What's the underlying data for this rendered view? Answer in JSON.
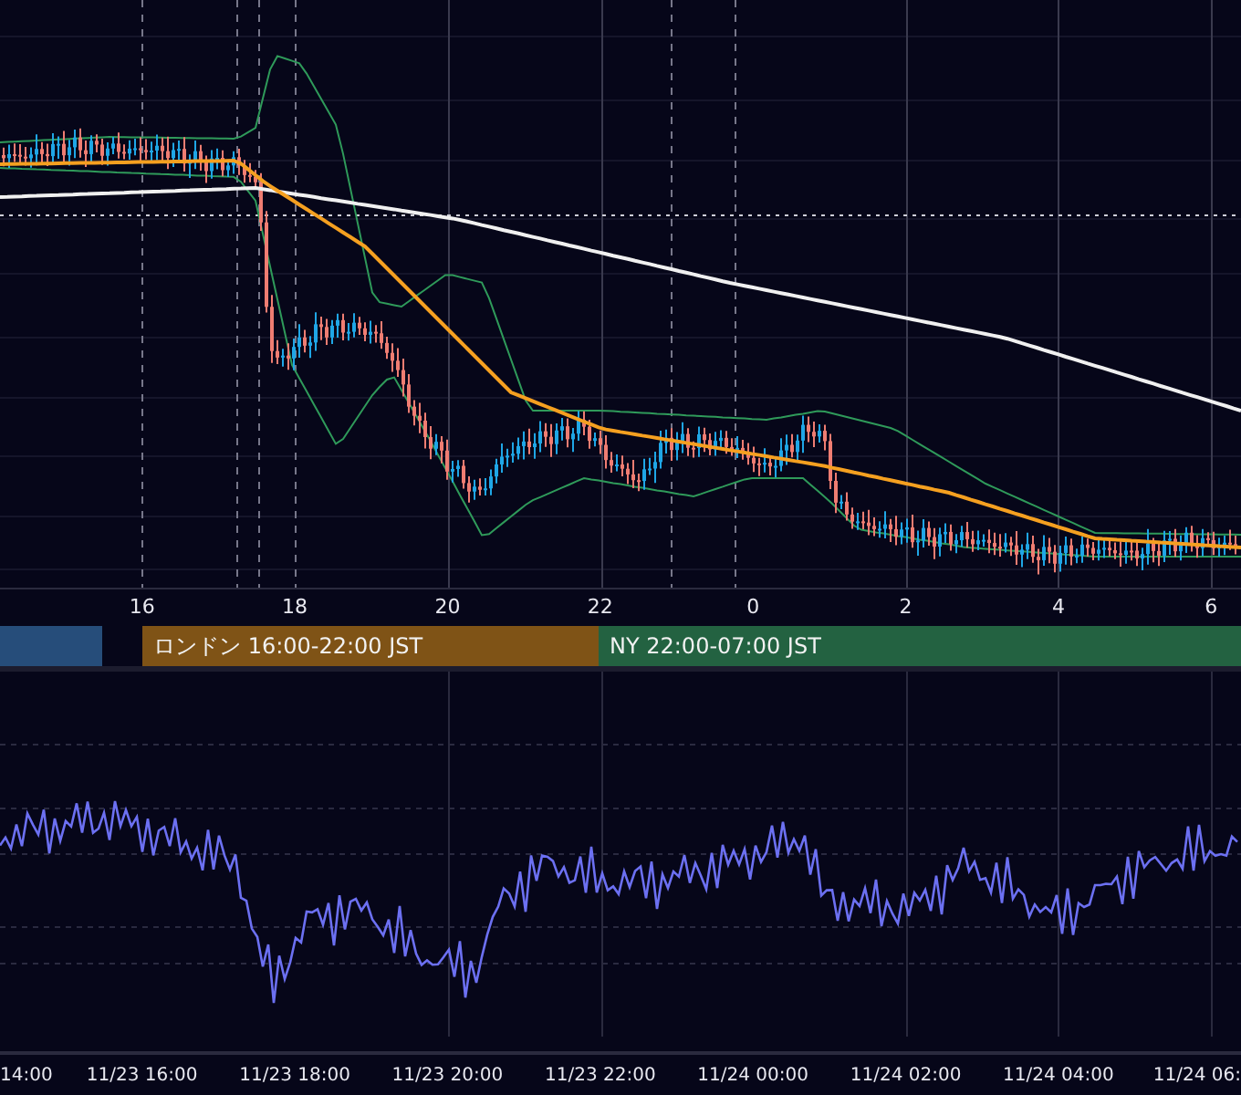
{
  "price_chart": {
    "hour_axis": [
      "16",
      "18",
      "20",
      "22",
      "0",
      "2",
      "4",
      "6"
    ]
  },
  "sessions": [
    {
      "color": "#264d7a"
    },
    {
      "label": "ロンドン 16:00-22:00 JST",
      "color": "#7f5316"
    },
    {
      "label": "NY 22:00-07:00 JST",
      "color": "#236241"
    }
  ],
  "time_axis": [
    "14:00",
    "11/23 16:00",
    "11/23 18:00",
    "11/23 20:00",
    "11/23 22:00",
    "11/24 00:00",
    "11/24 02:00",
    "11/24 04:00",
    "11/24 06:"
  ]
}
